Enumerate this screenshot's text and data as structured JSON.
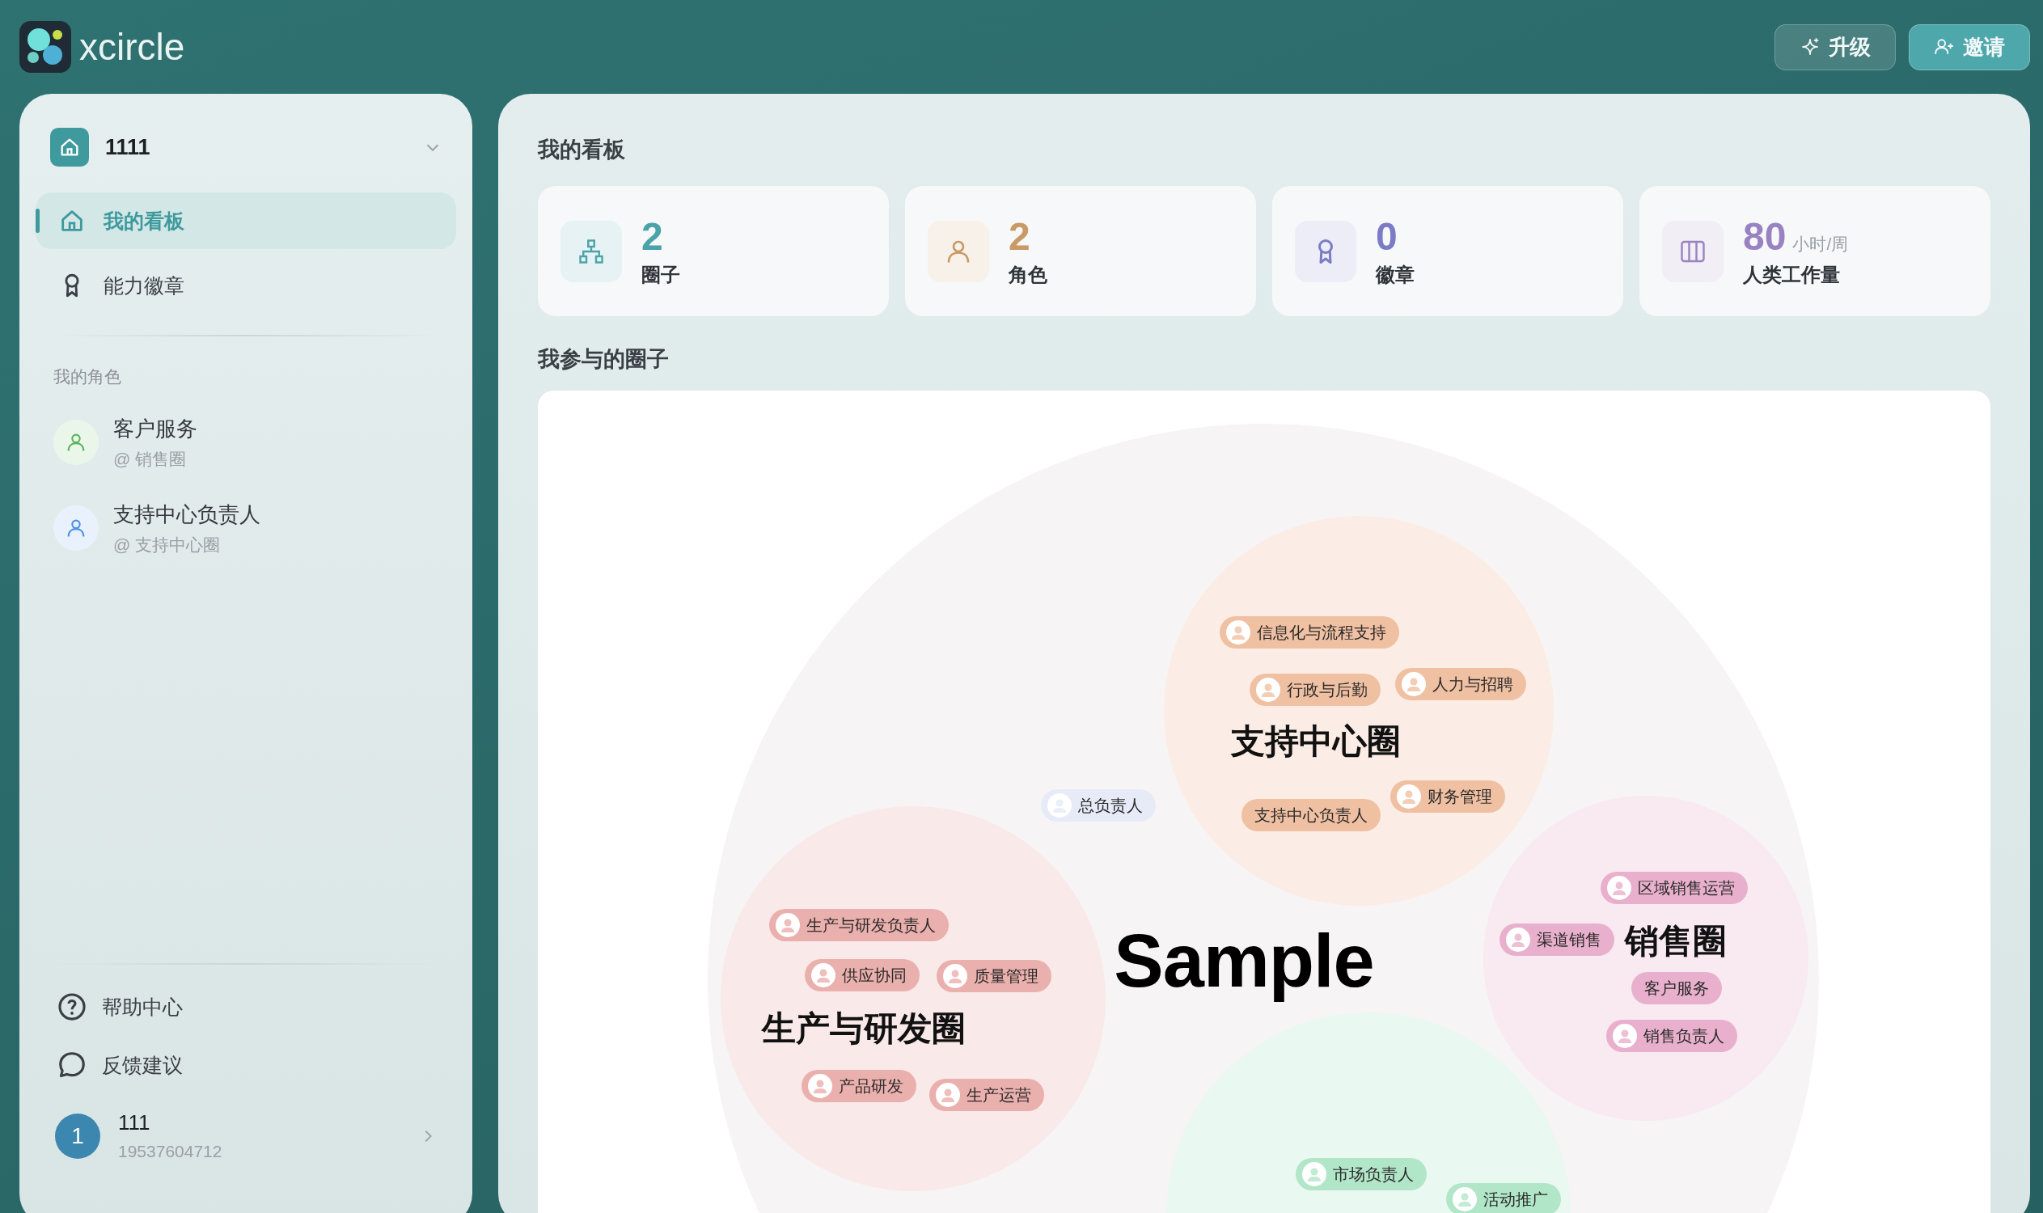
{
  "brand": {
    "name": "xcircle"
  },
  "header_buttons": [
    {
      "label": "升级",
      "kind": "secondary"
    },
    {
      "label": "邀请",
      "kind": "primary"
    }
  ],
  "sidebar": {
    "workspace": "1111",
    "nav": [
      {
        "label": "我的看板",
        "selected": true
      },
      {
        "label": "能力徽章",
        "selected": false
      }
    ],
    "roles_title": "我的角色",
    "roles": [
      {
        "name": "客户服务",
        "circle": "@ 销售圈",
        "color": "#5bb35a"
      },
      {
        "name": "支持中心负责人",
        "circle": "@ 支持中心圈",
        "color": "#4a8fe8"
      }
    ],
    "links": [
      {
        "label": "帮助中心"
      },
      {
        "label": "反馈建议"
      }
    ],
    "user": {
      "initial": "1",
      "name": "111",
      "phone": "19537604712"
    }
  },
  "dashboard": {
    "title": "我的看板",
    "stats": [
      {
        "value": "2",
        "label": "圈子",
        "color": "#4aa3a8"
      },
      {
        "value": "2",
        "label": "角色",
        "color": "#c99a66"
      },
      {
        "value": "0",
        "label": "徽章",
        "color": "#7b7bc6"
      },
      {
        "value": "80",
        "unit": "小时/周",
        "label": "人类工作量",
        "color": "#9a82c2"
      }
    ]
  },
  "circles_section": {
    "title": "我参与的圈子",
    "diagram": {
      "center_label": "Sample",
      "lead": {
        "label": "总负责人"
      },
      "circles": [
        {
          "title": "支持中心圈",
          "color": "#f0c0a2",
          "members": [
            {
              "label": "信息化与流程支持",
              "kind": "person"
            },
            {
              "label": "行政与后勤",
              "kind": "person"
            },
            {
              "label": "人力与招聘",
              "kind": "person"
            },
            {
              "label": "财务管理",
              "kind": "person"
            },
            {
              "label": "支持中心负责人",
              "kind": "text"
            }
          ]
        },
        {
          "title": "生产与研发圈",
          "color": "#eab0ad",
          "members": [
            {
              "label": "生产与研发负责人",
              "kind": "person"
            },
            {
              "label": "供应协同",
              "kind": "person"
            },
            {
              "label": "质量管理",
              "kind": "person"
            },
            {
              "label": "产品研发",
              "kind": "person"
            },
            {
              "label": "生产运营",
              "kind": "person"
            }
          ]
        },
        {
          "title": "销售圈",
          "color": "#e8b0cc",
          "members": [
            {
              "label": "区域销售运营",
              "kind": "person"
            },
            {
              "label": "渠道销售",
              "kind": "person"
            },
            {
              "label": "客户服务",
              "kind": "text"
            },
            {
              "label": "销售负责人",
              "kind": "person"
            }
          ]
        },
        {
          "color": "#b2e6c8",
          "members": [
            {
              "label": "市场负责人",
              "kind": "person"
            },
            {
              "label": "活动推广",
              "kind": "person"
            }
          ]
        }
      ]
    }
  }
}
